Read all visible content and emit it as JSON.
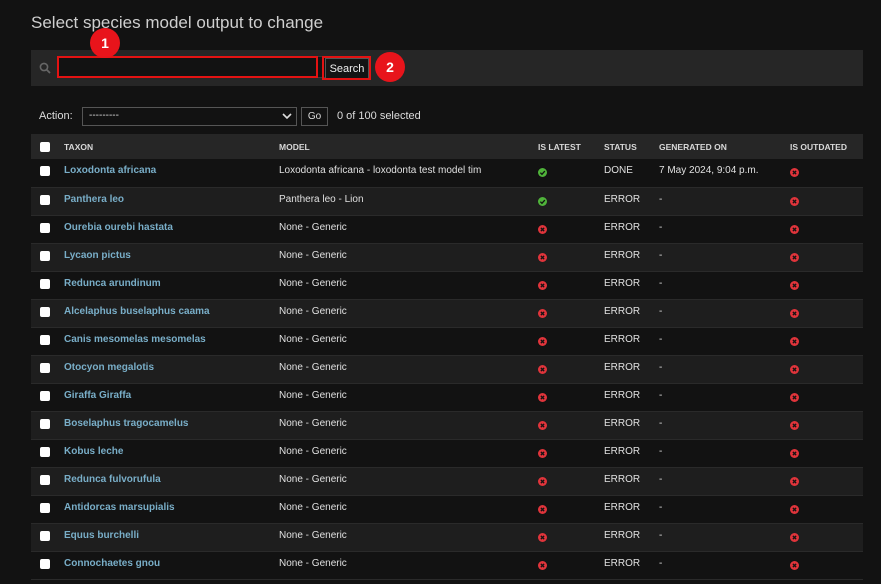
{
  "page": {
    "title": "Select species model output to change"
  },
  "search": {
    "value": "",
    "placeholder": "",
    "button_label": "Search"
  },
  "markers": {
    "one": "1",
    "two": "2"
  },
  "actions": {
    "label": "Action:",
    "selected": "---------",
    "go_label": "Go",
    "counter": "0 of 100 selected"
  },
  "table": {
    "headers": {
      "taxon": "TAXON",
      "model": "MODEL",
      "is_latest": "IS LATEST",
      "status": "STATUS",
      "generated_on": "GENERATED ON",
      "is_outdated": "IS OUTDATED"
    },
    "rows": [
      {
        "taxon": "Loxodonta africana",
        "model": "Loxodonta africana - loxodonta test model tim",
        "is_latest": true,
        "status": "DONE",
        "generated_on": "7 May 2024, 9:04 p.m.",
        "is_outdated": false
      },
      {
        "taxon": "Panthera leo",
        "model": "Panthera leo - Lion",
        "is_latest": true,
        "status": "ERROR",
        "generated_on": "-",
        "is_outdated": false
      },
      {
        "taxon": "Ourebia ourebi hastata",
        "model": "None - Generic",
        "is_latest": false,
        "status": "ERROR",
        "generated_on": "-",
        "is_outdated": false
      },
      {
        "taxon": "Lycaon pictus",
        "model": "None - Generic",
        "is_latest": false,
        "status": "ERROR",
        "generated_on": "-",
        "is_outdated": false
      },
      {
        "taxon": "Redunca arundinum",
        "model": "None - Generic",
        "is_latest": false,
        "status": "ERROR",
        "generated_on": "-",
        "is_outdated": false
      },
      {
        "taxon": "Alcelaphus buselaphus caama",
        "model": "None - Generic",
        "is_latest": false,
        "status": "ERROR",
        "generated_on": "-",
        "is_outdated": false
      },
      {
        "taxon": "Canis mesomelas mesomelas",
        "model": "None - Generic",
        "is_latest": false,
        "status": "ERROR",
        "generated_on": "-",
        "is_outdated": false
      },
      {
        "taxon": "Otocyon megalotis",
        "model": "None - Generic",
        "is_latest": false,
        "status": "ERROR",
        "generated_on": "-",
        "is_outdated": false
      },
      {
        "taxon": "Giraffa Giraffa",
        "model": "None - Generic",
        "is_latest": false,
        "status": "ERROR",
        "generated_on": "-",
        "is_outdated": false
      },
      {
        "taxon": "Boselaphus tragocamelus",
        "model": "None - Generic",
        "is_latest": false,
        "status": "ERROR",
        "generated_on": "-",
        "is_outdated": false
      },
      {
        "taxon": "Kobus leche",
        "model": "None - Generic",
        "is_latest": false,
        "status": "ERROR",
        "generated_on": "-",
        "is_outdated": false
      },
      {
        "taxon": "Redunca fulvorufula",
        "model": "None - Generic",
        "is_latest": false,
        "status": "ERROR",
        "generated_on": "-",
        "is_outdated": false
      },
      {
        "taxon": "Antidorcas marsupialis",
        "model": "None - Generic",
        "is_latest": false,
        "status": "ERROR",
        "generated_on": "-",
        "is_outdated": false
      },
      {
        "taxon": "Equus burchelli",
        "model": "None - Generic",
        "is_latest": false,
        "status": "ERROR",
        "generated_on": "-",
        "is_outdated": false
      },
      {
        "taxon": "Connochaetes gnou",
        "model": "None - Generic",
        "is_latest": false,
        "status": "ERROR",
        "generated_on": "-",
        "is_outdated": false
      }
    ]
  },
  "colors": {
    "background": "#121212",
    "link": "#79aec8",
    "highlight": "#e31212",
    "ok": "#4fb33a",
    "error": "#e0343b"
  }
}
